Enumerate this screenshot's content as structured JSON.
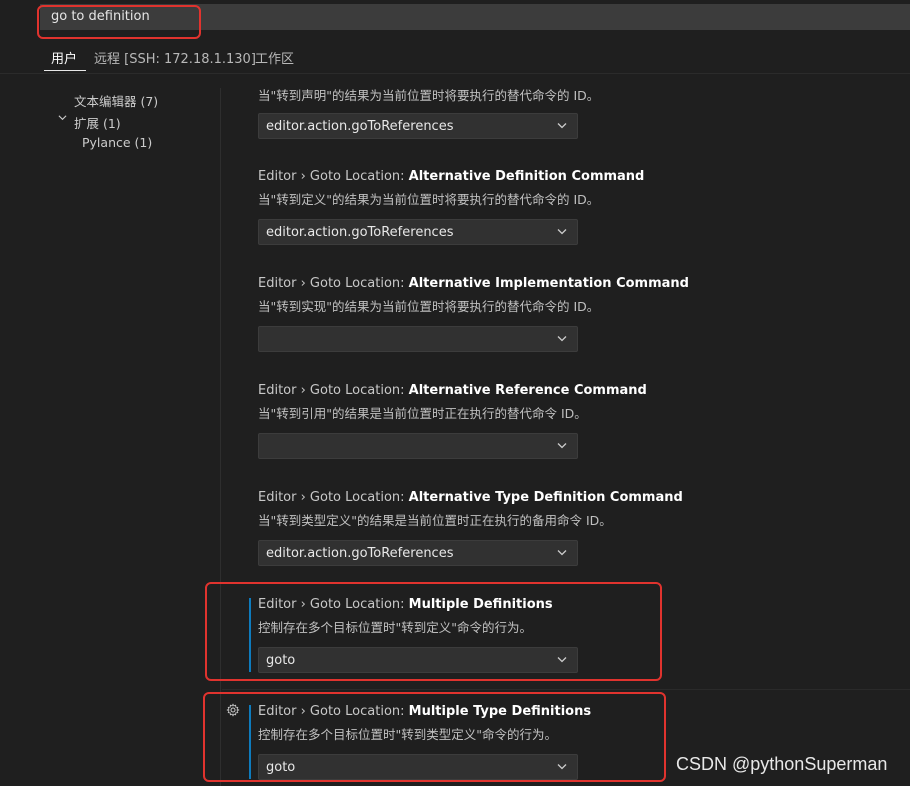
{
  "search": {
    "value": "go to definition"
  },
  "tabs": [
    {
      "label": "用户"
    },
    {
      "label": "远程 [SSH: 172.18.1.130]"
    },
    {
      "label": "工作区"
    }
  ],
  "toc": {
    "items": [
      {
        "label": "文本编辑器 (7)"
      },
      {
        "label": "扩展 (1)"
      },
      {
        "label": "Pylance (1)"
      }
    ]
  },
  "top_partial_desc": "当\"转到声明\"的结果为当前位置时将要执行的替代命令的 ID。",
  "top_partial_value": "editor.action.goToReferences",
  "settings": [
    {
      "prefix": "Editor › Goto Location: ",
      "name": "Alternative Definition Command",
      "desc": "当\"转到定义\"的结果为当前位置时将要执行的替代命令的 ID。",
      "value": "editor.action.goToReferences"
    },
    {
      "prefix": "Editor › Goto Location: ",
      "name": "Alternative Implementation Command",
      "desc": "当\"转到实现\"的结果为当前位置时将要执行的替代命令的 ID。",
      "value": ""
    },
    {
      "prefix": "Editor › Goto Location: ",
      "name": "Alternative Reference Command",
      "desc": "当\"转到引用\"的结果是当前位置时正在执行的替代命令 ID。",
      "value": ""
    },
    {
      "prefix": "Editor › Goto Location: ",
      "name": "Alternative Type Definition Command",
      "desc": "当\"转到类型定义\"的结果是当前位置时正在执行的备用命令 ID。",
      "value": "editor.action.goToReferences"
    },
    {
      "prefix": "Editor › Goto Location: ",
      "name": "Multiple Definitions",
      "desc": "控制存在多个目标位置时\"转到定义\"命令的行为。",
      "value": "goto"
    },
    {
      "prefix": "Editor › Goto Location: ",
      "name": "Multiple Type Definitions",
      "desc": "控制存在多个目标位置时\"转到类型定义\"命令的行为。",
      "value": "goto"
    }
  ],
  "watermark": "CSDN @pythonSuperman",
  "colors": {
    "accent": "#0e7bbd",
    "highlight_box": "#e0332e"
  },
  "icons": {
    "gear": "gear-icon",
    "chevron": "chevron-down-icon"
  }
}
